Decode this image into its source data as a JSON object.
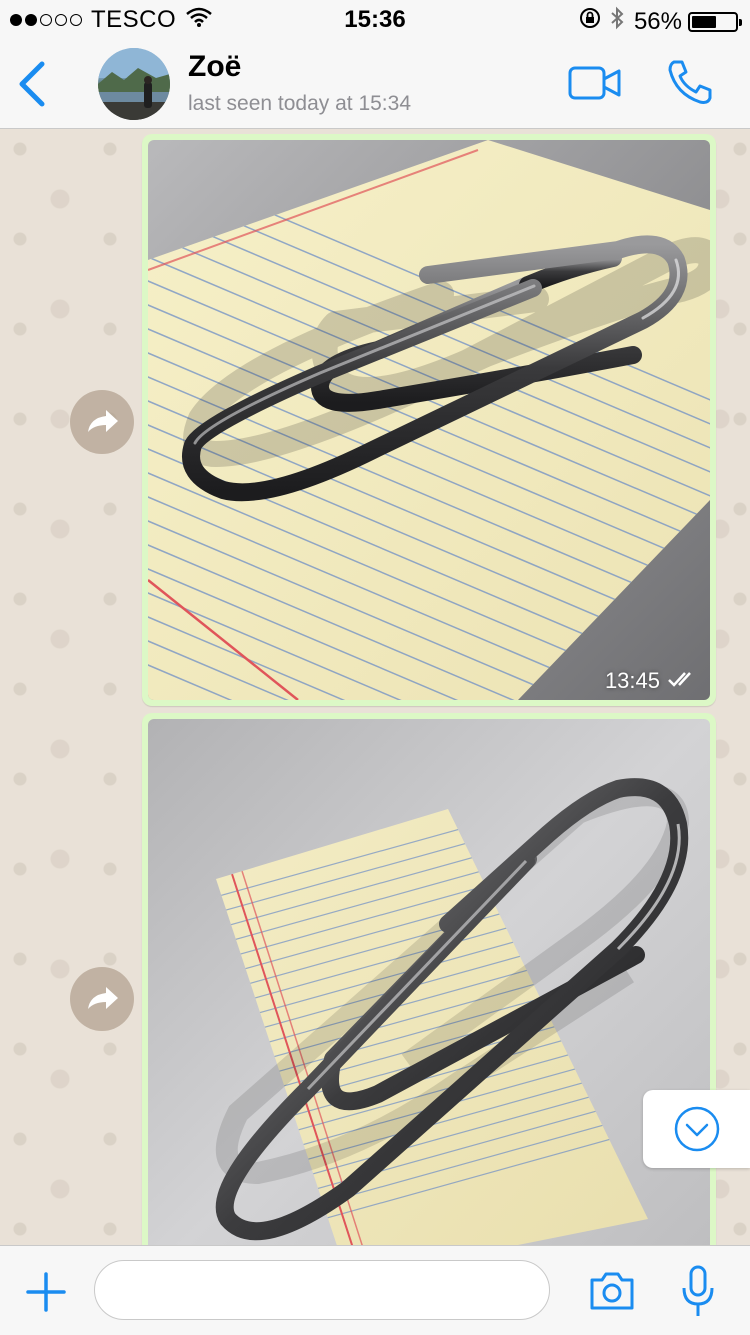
{
  "status_bar": {
    "signal_bars_filled": 2,
    "signal_bars_total": 5,
    "carrier": "TESCO",
    "time": "15:36",
    "battery_percent": "56%",
    "battery_level": 0.56,
    "icons": [
      "wifi-icon",
      "rotation-lock-icon",
      "bluetooth-icon",
      "battery-icon"
    ]
  },
  "header": {
    "back_icon": "chevron-left-icon",
    "contact_name": "Zoë",
    "last_seen": "last seen today at 15:34",
    "video_call_icon": "video-camera-icon",
    "voice_call_icon": "phone-icon"
  },
  "messages": [
    {
      "type": "image",
      "subject": "paperclip on lined paper",
      "time": "13:45",
      "status_icon": "double-check-icon"
    },
    {
      "type": "image",
      "subject": "paperclip on lined paper",
      "time": "",
      "status_icon": ""
    }
  ],
  "scroll_down_icon": "chevron-down-circle-icon",
  "composer": {
    "plus_icon": "plus-icon",
    "input_value": "",
    "input_placeholder": "",
    "camera_icon": "camera-icon",
    "mic_icon": "microphone-icon"
  },
  "colors": {
    "accent": "#1a8cf0",
    "outgoing_bubble": "#dcf8c6",
    "chat_background": "#e9e1d7",
    "read_receipt": "#ffffff"
  }
}
